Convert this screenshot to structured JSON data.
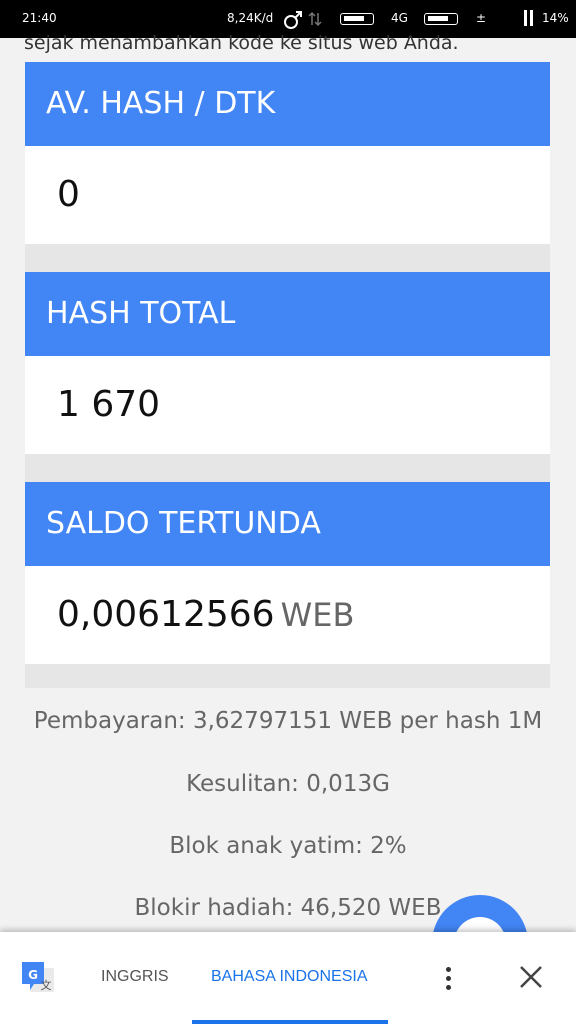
{
  "status_bar": {
    "time": "21:40",
    "net_speed": "8,24K/d",
    "network": "4G",
    "plus_minus": "±",
    "battery": "14%"
  },
  "page": {
    "snippet": "sejak menambahkan kode ke situs web Anda.",
    "cards": [
      {
        "title": "AV. HASH / DTK",
        "value": "0",
        "unit": ""
      },
      {
        "title": "HASH TOTAL",
        "value": "1 670",
        "unit": ""
      },
      {
        "title": "SALDO TERTUNDA",
        "value": "0,00612566",
        "unit": "WEB"
      }
    ],
    "stats": [
      "Pembayaran: 3,62797151 WEB per hash 1M",
      "Kesulitan: 0,013G",
      "Blok anak yatim: 2%",
      "Blokir hadiah: 46,520 WEB"
    ]
  },
  "translate_bar": {
    "source_lang": "INGGRIS",
    "target_lang": "BAHASA INDONESIA",
    "accent": "#1a73e8"
  }
}
